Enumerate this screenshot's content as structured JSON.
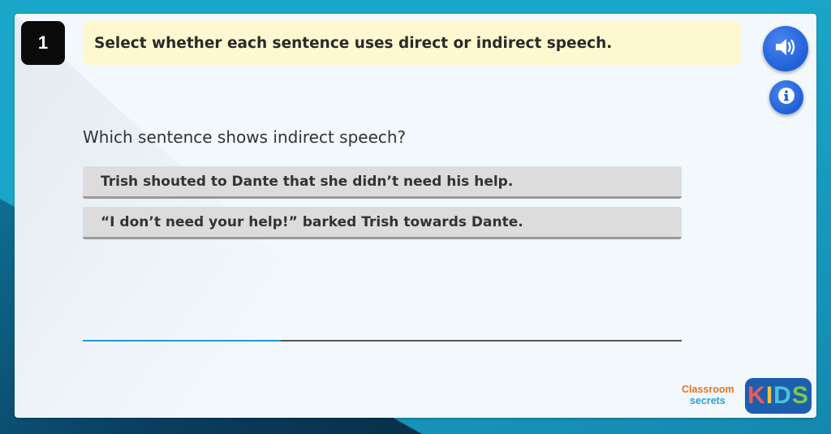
{
  "question_number": "1",
  "instruction": "Select whether each sentence uses direct or indirect speech.",
  "question": "Which sentence shows indirect speech?",
  "options": [
    "Trish shouted to Dante that she didn’t need his help.",
    "“I don’t need your help!” barked Trish towards Dante."
  ],
  "controls": {
    "audio_icon": "speaker-icon",
    "info_icon": "info-icon"
  },
  "progress": {
    "fraction": 0.33
  },
  "branding": {
    "classroom_line1": "Classroom",
    "classroom_line2": "secrets",
    "kids_letters": [
      "K",
      "I",
      "D",
      "S"
    ]
  },
  "colors": {
    "frame": "#1aa6c8",
    "instruction_bg": "#fdf8d0",
    "button_blue": "#1f5fd6",
    "option_bg": "#dcdcdc",
    "progress_fill": "#1f9ad8"
  }
}
